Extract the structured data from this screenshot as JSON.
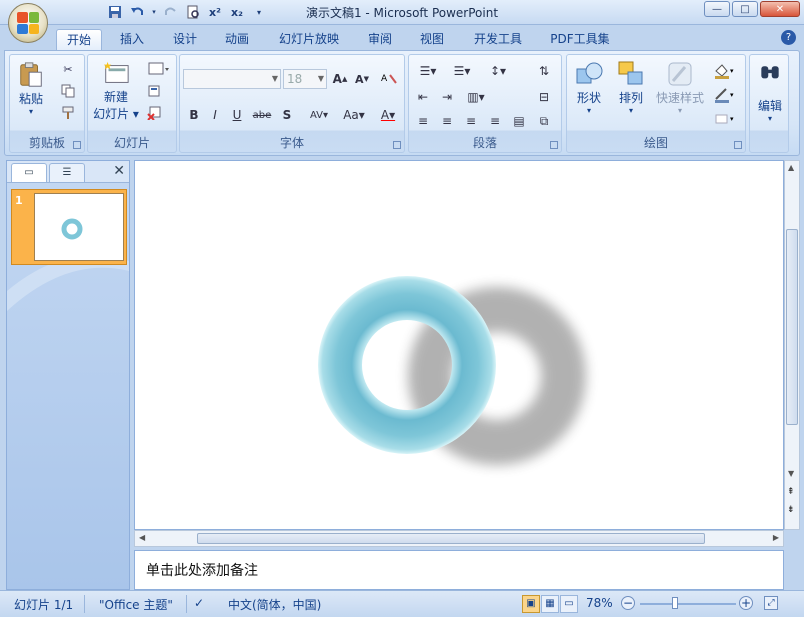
{
  "window": {
    "title": "演示文稿1 - Microsoft PowerPoint"
  },
  "qat": {
    "save_icon": "save-icon",
    "undo_icon": "undo-icon",
    "redo_icon": "redo-icon",
    "preview_icon": "print-preview-icon",
    "superscript_label": "x²",
    "subscript_label": "x₂",
    "customize_icon": "chevron-down-icon"
  },
  "tabs": [
    {
      "label": "开始"
    },
    {
      "label": "插入"
    },
    {
      "label": "设计"
    },
    {
      "label": "动画"
    },
    {
      "label": "幻灯片放映"
    },
    {
      "label": "审阅"
    },
    {
      "label": "视图"
    },
    {
      "label": "开发工具"
    },
    {
      "label": "PDF工具集"
    }
  ],
  "groups": {
    "clipboard": {
      "label": "剪贴板",
      "paste": "粘贴"
    },
    "slides": {
      "label": "幻灯片",
      "new_slide_1": "新建",
      "new_slide_2": "幻灯片"
    },
    "font": {
      "label": "字体",
      "font_name": "",
      "font_size": "18"
    },
    "paragraph": {
      "label": "段落"
    },
    "drawing": {
      "label": "绘图",
      "shapes": "形状",
      "arrange": "排列",
      "quick_styles": "快速样式"
    },
    "editing": {
      "label": "编辑"
    }
  },
  "notes": {
    "placeholder": "单击此处添加备注"
  },
  "status": {
    "slide": "幻灯片 1/1",
    "theme": "\"Office 主题\"",
    "language": "中文(简体，中国)",
    "zoom": "78%"
  },
  "thumb": {
    "number": "1"
  },
  "colors": {
    "accent": "#15428b",
    "ring": "#7ec6d8",
    "thumb_border": "#fbb34a"
  }
}
